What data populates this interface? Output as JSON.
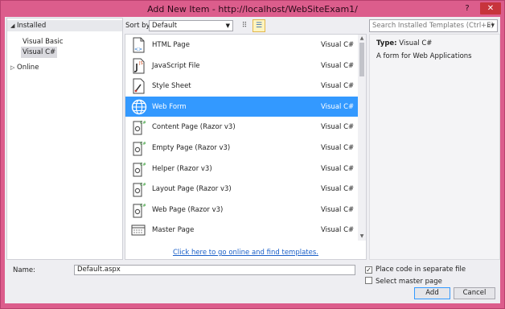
{
  "window": {
    "title": "Add New Item - http://localhost/WebSiteExam1/",
    "help_glyph": "?",
    "close_glyph": "✕"
  },
  "tree": {
    "installed": "Installed",
    "visual_basic": "Visual Basic",
    "visual_csharp": "Visual C#",
    "online": "Online"
  },
  "sort": {
    "label": "Sort by:",
    "value": "Default"
  },
  "search": {
    "placeholder": "Search Installed Templates (Ctrl+E)"
  },
  "templates": [
    {
      "name": "HTML Page",
      "lang": "Visual C#",
      "icon": "html-page-icon",
      "selected": false
    },
    {
      "name": "JavaScript File",
      "lang": "Visual C#",
      "icon": "javascript-file-icon",
      "selected": false
    },
    {
      "name": "Style Sheet",
      "lang": "Visual C#",
      "icon": "style-sheet-icon",
      "selected": false
    },
    {
      "name": "Web Form",
      "lang": "Visual C#",
      "icon": "globe-icon",
      "selected": true
    },
    {
      "name": "Content Page (Razor v3)",
      "lang": "Visual C#",
      "icon": "razor-page-icon",
      "selected": false
    },
    {
      "name": "Empty Page (Razor v3)",
      "lang": "Visual C#",
      "icon": "razor-page-icon",
      "selected": false
    },
    {
      "name": "Helper (Razor v3)",
      "lang": "Visual C#",
      "icon": "razor-page-icon",
      "selected": false
    },
    {
      "name": "Layout Page (Razor v3)",
      "lang": "Visual C#",
      "icon": "razor-page-icon",
      "selected": false
    },
    {
      "name": "Web Page (Razor v3)",
      "lang": "Visual C#",
      "icon": "razor-page-icon",
      "selected": false
    },
    {
      "name": "Master Page",
      "lang": "Visual C#",
      "icon": "master-page-icon",
      "selected": false
    }
  ],
  "online_link": "Click here to go online and find templates.",
  "details": {
    "type_label": "Type:",
    "type_value": "Visual C#",
    "description": "A form for Web Applications"
  },
  "bottom": {
    "name_label": "Name:",
    "name_value": "Default.aspx",
    "chk_separate": "Place code in separate file",
    "chk_separate_checked": true,
    "chk_master": "Select master page",
    "chk_master_checked": false,
    "add": "Add",
    "cancel": "Cancel"
  },
  "colors": {
    "frame": "#dc5d8c",
    "selection": "#3399ff",
    "link": "#1a5fc8"
  }
}
